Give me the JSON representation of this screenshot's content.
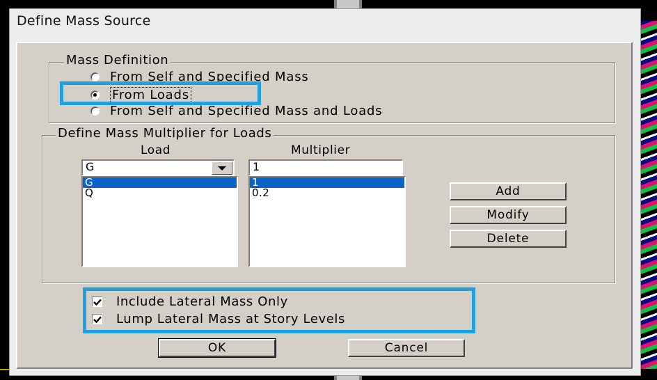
{
  "window": {
    "title": "Define Mass Source"
  },
  "mass_definition": {
    "label": "Mass Definition",
    "options": [
      {
        "label": "From Self and Specified Mass",
        "checked": false
      },
      {
        "label": "From Loads",
        "checked": true
      },
      {
        "label": "From Self and Specified Mass and Loads",
        "checked": false
      }
    ]
  },
  "multiplier_group": {
    "label": "Define Mass Multiplier for Loads",
    "load_header": "Load",
    "multiplier_header": "Multiplier",
    "load_input_value": "G",
    "multiplier_input_value": "1",
    "rows": [
      {
        "load": "G",
        "multiplier": "1",
        "selected": true
      },
      {
        "load": "Q",
        "multiplier": "0.2",
        "selected": false
      }
    ]
  },
  "buttons": {
    "add": "Add",
    "modify": "Modify",
    "delete": "Delete",
    "ok": "OK",
    "cancel": "Cancel"
  },
  "options": {
    "lateral_only": {
      "label": "Include Lateral Mass Only",
      "checked": true
    },
    "lump_lateral": {
      "label": "Lump Lateral Mass at Story Levels",
      "checked": true
    }
  },
  "colors": {
    "annotation_highlight": "#1fa0e0",
    "selection": "#0a64c8",
    "dialog_face": "#d4d0c8"
  }
}
